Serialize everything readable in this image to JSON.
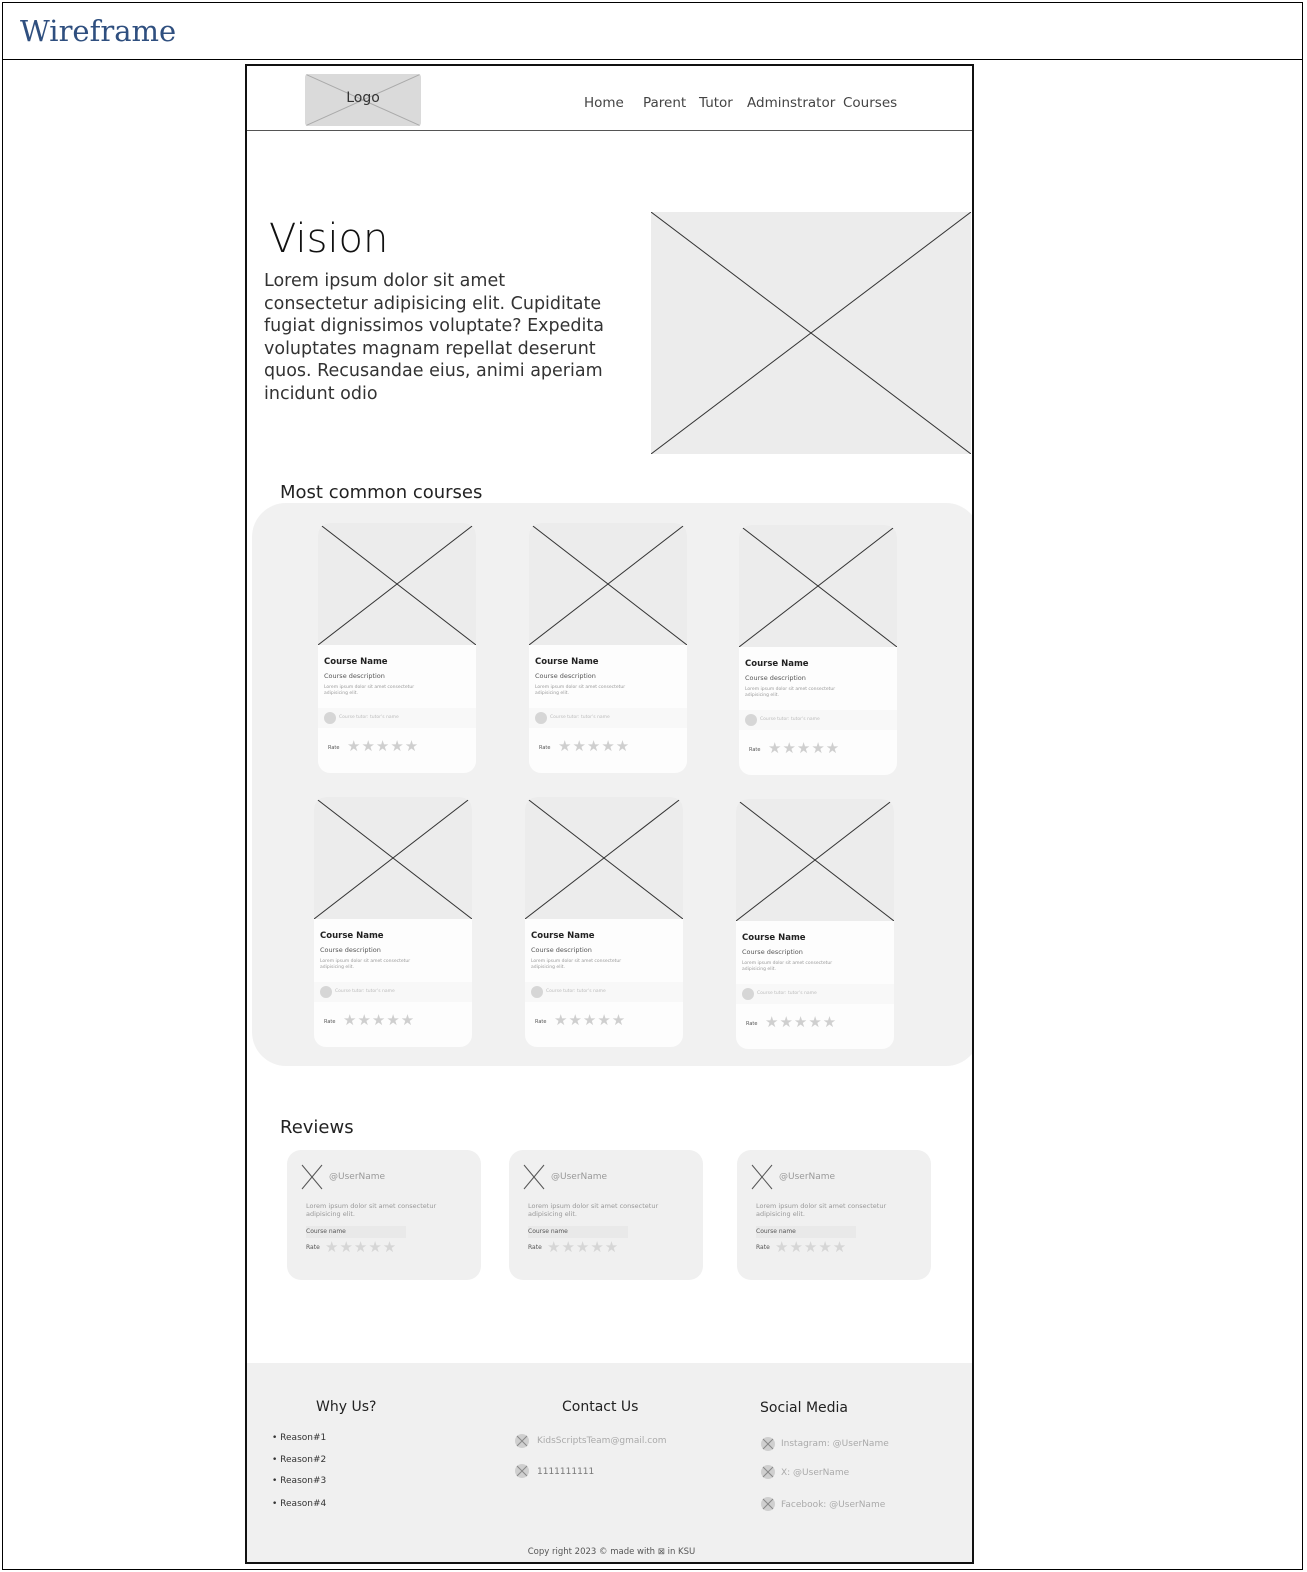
{
  "document": {
    "title": "Wireframe"
  },
  "header": {
    "logo_label": "Logo",
    "nav": [
      "Home",
      "Parent",
      "Tutor",
      "Adminstrator",
      "Courses"
    ]
  },
  "hero": {
    "title": "Vision",
    "text": "Lorem ipsum dolor sit amet consectetur adipisicing elit. Cupiditate fugiat dignissimos voluptate? Expedita voluptates magnam repellat deserunt quos. Recusandae eius, animi aperiam incidunt odio"
  },
  "courses": {
    "title": "Most common courses",
    "cards": [
      {
        "name": "Course Name",
        "description": "Course description",
        "lorem": "Lorem ipsum dolor sit amet consectetur adipisicing elit.",
        "tutor": "Course tutor: tutor's name",
        "rate_label": "Rate",
        "stars": "★★★★★"
      },
      {
        "name": "Course Name",
        "description": "Course description",
        "lorem": "Lorem ipsum dolor sit amet consectetur adipisicing elit.",
        "tutor": "Course tutor: tutor's name",
        "rate_label": "Rate",
        "stars": "★★★★★"
      },
      {
        "name": "Course Name",
        "description": "Course description",
        "lorem": "Lorem ipsum dolor sit amet consectetur adipisicing elit.",
        "tutor": "Course tutor: tutor's name",
        "rate_label": "Rate",
        "stars": "★★★★★"
      },
      {
        "name": "Course Name",
        "description": "Course description",
        "lorem": "Lorem ipsum dolor sit amet consectetur adipisicing elit.",
        "tutor": "Course tutor: tutor's name",
        "rate_label": "Rate",
        "stars": "★★★★★"
      },
      {
        "name": "Course Name",
        "description": "Course description",
        "lorem": "Lorem ipsum dolor sit amet consectetur adipisicing elit.",
        "tutor": "Course tutor: tutor's name",
        "rate_label": "Rate",
        "stars": "★★★★★"
      },
      {
        "name": "Course Name",
        "description": "Course description",
        "lorem": "Lorem ipsum dolor sit amet consectetur adipisicing elit.",
        "tutor": "Course tutor: tutor's name",
        "rate_label": "Rate",
        "stars": "★★★★★"
      }
    ]
  },
  "reviews": {
    "title": "Reviews",
    "items": [
      {
        "username": "@UserName",
        "text": "Lorem ipsum dolor sit amet consectetur adipisicing elit.",
        "course": "Course name",
        "rate_label": "Rate",
        "stars": "★★★★★"
      },
      {
        "username": "@UserName",
        "text": "Lorem ipsum dolor sit amet consectetur adipisicing elit.",
        "course": "Course name",
        "rate_label": "Rate",
        "stars": "★★★★★"
      },
      {
        "username": "@UserName",
        "text": "Lorem ipsum dolor sit amet consectetur adipisicing elit.",
        "course": "Course name",
        "rate_label": "Rate",
        "stars": "★★★★★"
      }
    ]
  },
  "footer": {
    "why_us": {
      "title": "Why Us?",
      "items": [
        "Reason#1",
        "Reason#2",
        "Reason#3",
        "Reason#4"
      ]
    },
    "contact": {
      "title": "Contact Us",
      "email": "KidsScriptsTeam@gmail.com",
      "phone": "1111111111"
    },
    "social": {
      "title": "Social Media",
      "instagram": "Instagram: @UserName",
      "x": "X: @UserName",
      "facebook": "Facebook: @UserName"
    },
    "copyright": "Copy right 2023 © made with ⊠ in KSU"
  },
  "colors": {
    "doc_title": "#2f4f7f",
    "placeholder": "#ececec",
    "section_bg": "#f1f1f1",
    "footer_bg": "#f0f0f0"
  }
}
